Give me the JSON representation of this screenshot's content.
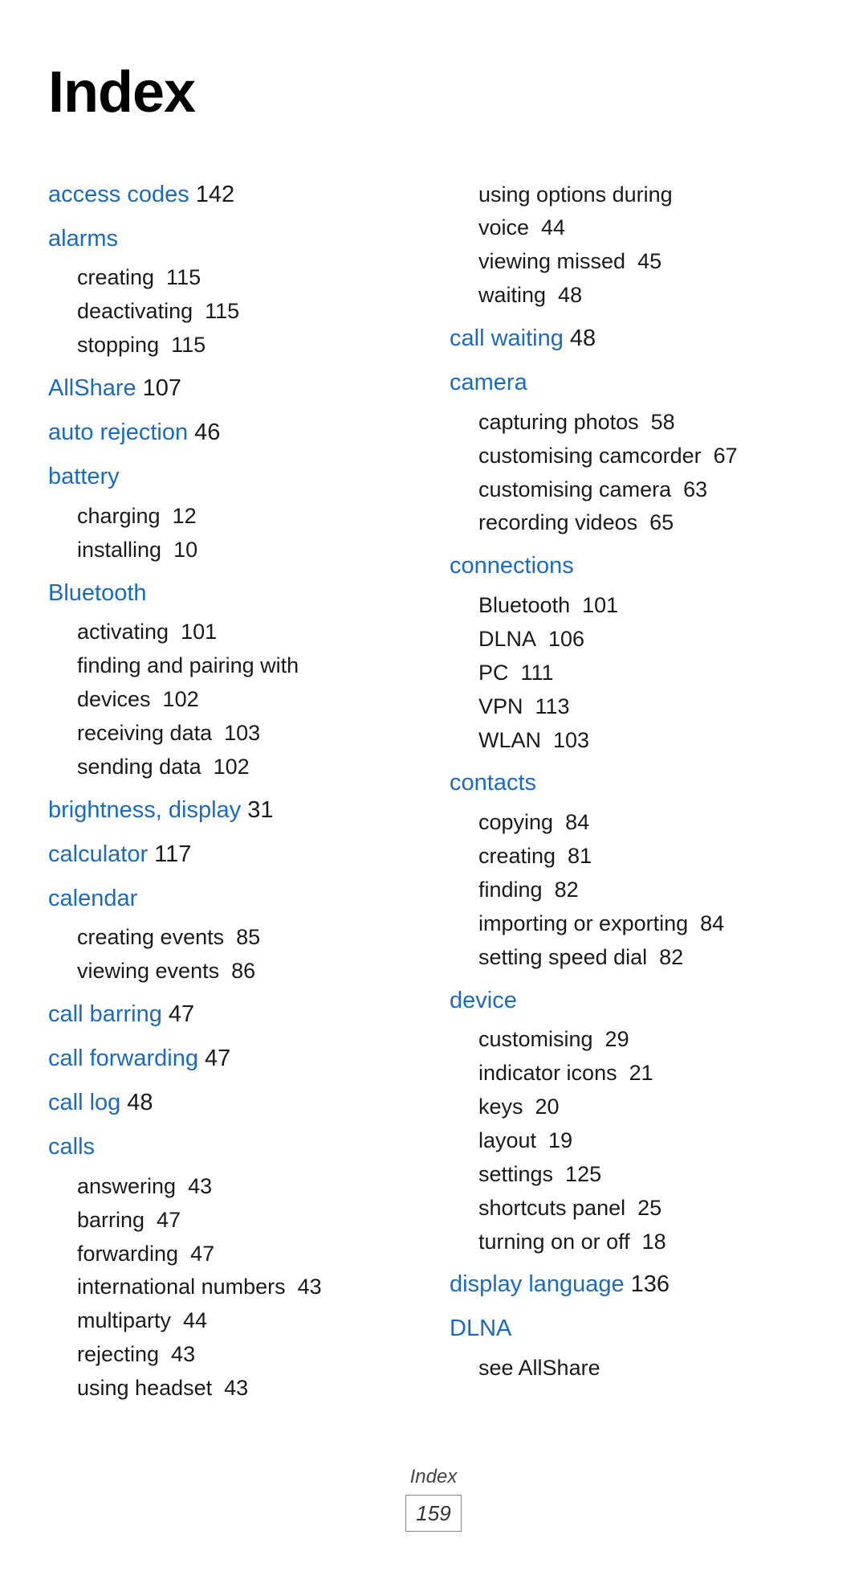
{
  "page": {
    "title": "Index",
    "footer_label": "Index",
    "footer_page": "159"
  },
  "left_column": [
    {
      "heading": "access codes",
      "heading_num": "142",
      "sub_items": []
    },
    {
      "heading": "alarms",
      "heading_num": "",
      "sub_items": [
        {
          "text": "creating",
          "num": "115"
        },
        {
          "text": "deactivating",
          "num": "115"
        },
        {
          "text": "stopping",
          "num": "115"
        }
      ]
    },
    {
      "heading": "AllShare",
      "heading_num": "107",
      "sub_items": []
    },
    {
      "heading": "auto rejection",
      "heading_num": "46",
      "sub_items": []
    },
    {
      "heading": "battery",
      "heading_num": "",
      "sub_items": [
        {
          "text": "charging",
          "num": "12"
        },
        {
          "text": "installing",
          "num": "10"
        }
      ]
    },
    {
      "heading": "Bluetooth",
      "heading_num": "",
      "sub_items": [
        {
          "text": "activating",
          "num": "101"
        },
        {
          "text": "finding and pairing with devices",
          "num": "102"
        },
        {
          "text": "receiving data",
          "num": "103"
        },
        {
          "text": "sending data",
          "num": "102"
        }
      ]
    },
    {
      "heading": "brightness, display",
      "heading_num": "31",
      "sub_items": []
    },
    {
      "heading": "calculator",
      "heading_num": "117",
      "sub_items": []
    },
    {
      "heading": "calendar",
      "heading_num": "",
      "sub_items": [
        {
          "text": "creating events",
          "num": "85"
        },
        {
          "text": "viewing events",
          "num": "86"
        }
      ]
    },
    {
      "heading": "call barring",
      "heading_num": "47",
      "sub_items": []
    },
    {
      "heading": "call forwarding",
      "heading_num": "47",
      "sub_items": []
    },
    {
      "heading": "call log",
      "heading_num": "48",
      "sub_items": []
    },
    {
      "heading": "calls",
      "heading_num": "",
      "sub_items": [
        {
          "text": "answering",
          "num": "43"
        },
        {
          "text": "barring",
          "num": "47"
        },
        {
          "text": "forwarding",
          "num": "47"
        },
        {
          "text": "international numbers",
          "num": "43"
        },
        {
          "text": "multiparty",
          "num": "44"
        },
        {
          "text": "rejecting",
          "num": "43"
        },
        {
          "text": "using headset",
          "num": "43"
        }
      ]
    }
  ],
  "right_column": [
    {
      "heading": "",
      "heading_num": "",
      "sub_items": [
        {
          "text": "using options during",
          "num": ""
        },
        {
          "text": "voice",
          "num": "44"
        },
        {
          "text": "viewing missed",
          "num": "45"
        },
        {
          "text": "waiting",
          "num": "48"
        }
      ]
    },
    {
      "heading": "call waiting",
      "heading_num": "48",
      "sub_items": []
    },
    {
      "heading": "camera",
      "heading_num": "",
      "sub_items": [
        {
          "text": "capturing photos",
          "num": "58"
        },
        {
          "text": "customising camcorder",
          "num": "67"
        },
        {
          "text": "customising camera",
          "num": "63"
        },
        {
          "text": "recording videos",
          "num": "65"
        }
      ]
    },
    {
      "heading": "connections",
      "heading_num": "",
      "sub_items": [
        {
          "text": "Bluetooth",
          "num": "101"
        },
        {
          "text": "DLNA",
          "num": "106"
        },
        {
          "text": "PC",
          "num": "111"
        },
        {
          "text": "VPN",
          "num": "113"
        },
        {
          "text": "WLAN",
          "num": "103"
        }
      ]
    },
    {
      "heading": "contacts",
      "heading_num": "",
      "sub_items": [
        {
          "text": "copying",
          "num": "84"
        },
        {
          "text": "creating",
          "num": "81"
        },
        {
          "text": "finding",
          "num": "82"
        },
        {
          "text": "importing or exporting",
          "num": "84"
        },
        {
          "text": "setting speed dial",
          "num": "82"
        }
      ]
    },
    {
      "heading": "device",
      "heading_num": "",
      "sub_items": [
        {
          "text": "customising",
          "num": "29"
        },
        {
          "text": "indicator icons",
          "num": "21"
        },
        {
          "text": "keys",
          "num": "20"
        },
        {
          "text": "layout",
          "num": "19"
        },
        {
          "text": "settings",
          "num": "125"
        },
        {
          "text": "shortcuts panel",
          "num": "25"
        },
        {
          "text": "turning on or off",
          "num": "18"
        }
      ]
    },
    {
      "heading": "display language",
      "heading_num": "136",
      "sub_items": []
    },
    {
      "heading": "DLNA",
      "heading_num": "",
      "sub_items": [
        {
          "text": "see AllShare",
          "num": ""
        }
      ]
    }
  ]
}
